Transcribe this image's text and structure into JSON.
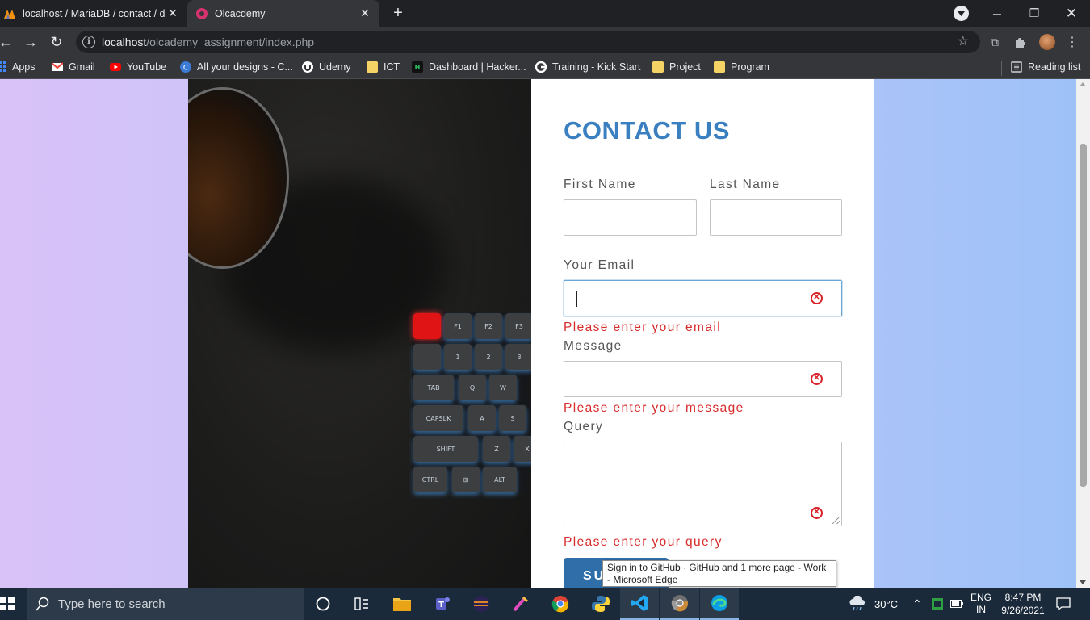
{
  "browser": {
    "tabs": [
      {
        "title": "localhost / MariaDB / contact / d",
        "active": false
      },
      {
        "title": "Olcacdemy",
        "active": true
      }
    ],
    "new_tab": "+",
    "url_host": "localhost",
    "url_path": "/olcademy_assignment/index.php",
    "bookmarks": [
      {
        "label": "Apps",
        "icon": "apps-grid-icon"
      },
      {
        "label": "Gmail",
        "icon": "gmail-icon"
      },
      {
        "label": "YouTube",
        "icon": "youtube-icon"
      },
      {
        "label": "All your designs - C...",
        "icon": "canva-icon"
      },
      {
        "label": "Udemy",
        "icon": "udemy-icon"
      },
      {
        "label": "ICT",
        "icon": "folder-icon"
      },
      {
        "label": "Dashboard | Hacker...",
        "icon": "hackerrank-icon"
      },
      {
        "label": "Training - Kick Start",
        "icon": "google-icon"
      },
      {
        "label": "Project",
        "icon": "folder-icon"
      },
      {
        "label": "Program",
        "icon": "folder-icon"
      }
    ],
    "reading_list": "Reading list"
  },
  "form": {
    "title": "CONTACT US",
    "first_name_label": "First Name",
    "last_name_label": "Last Name",
    "email_label": "Your Email",
    "email_error": "Please enter your email",
    "message_label": "Message",
    "message_error": "Please enter your message",
    "query_label": "Query",
    "query_error": "Please enter your query",
    "submit_label": "SU",
    "error_icon_glyph": "✕"
  },
  "tooltip": {
    "text": "Sign in to GitHub · GitHub and 1 more page - Work - Microsoft Edge"
  },
  "taskbar": {
    "search_placeholder": "Type here to search",
    "weather": "30°C",
    "lang_line1": "ENG",
    "lang_line2": "IN",
    "time": "8:47 PM",
    "date": "9/26/2021"
  },
  "colors": {
    "accent": "#3a80c0",
    "error": "#d72c2c",
    "button": "#2f6ea8",
    "page_gradient_left": "#d9c2f8",
    "page_gradient_right": "#9ec2f8"
  }
}
